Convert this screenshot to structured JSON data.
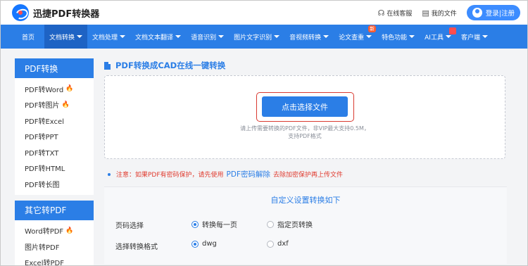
{
  "brand": {
    "name": "迅捷PDF转换器"
  },
  "top_links": [
    {
      "label": "在线客服",
      "icon": "headset-icon"
    },
    {
      "label": "我的文件",
      "icon": "file-icon"
    }
  ],
  "login": {
    "label": "登录|注册"
  },
  "nav": {
    "items": [
      {
        "label": "首页"
      },
      {
        "label": "文档转换"
      },
      {
        "label": "文档处理"
      },
      {
        "label": "文档文本翻译"
      },
      {
        "label": "语音识别"
      },
      {
        "label": "图片文字识别"
      },
      {
        "label": "音视频转换"
      },
      {
        "label": "论文查重"
      },
      {
        "label": "特色功能"
      },
      {
        "label": "AI工具"
      },
      {
        "label": "客户端"
      }
    ],
    "new_badge": "新"
  },
  "sidebar": {
    "section1_title": "PDF转换",
    "section1_items": [
      "PDF转Word",
      "PDF转图片",
      "PDF转Excel",
      "PDF转PPT",
      "PDF转TXT",
      "PDF转HTML",
      "PDF转长图"
    ],
    "section2_title": "其它转PDF",
    "section2_items": [
      "Word转PDF",
      "图片转PDF",
      "Excel转PDF"
    ]
  },
  "main": {
    "title": "PDF转换成CAD在线一键转换",
    "select_button": "点击选择文件",
    "hint_line1": "请上传需要转换的PDF文件，非VIP最大支持0.5M，",
    "hint_line2": "支持PDF格式",
    "notice_prefix": "注意：如果PDF有密码保护，请先使用",
    "notice_link": "PDF密码解除",
    "notice_suffix": "去除加密保护再上传文件"
  },
  "settings": {
    "title": "自定义设置转换如下",
    "page_label": "页码选择",
    "page_opt1": "转换每一页",
    "page_opt2": "指定页转换",
    "page_selected": "转换每一页",
    "format_label": "选择转换格式",
    "format_opt1": "dwg",
    "format_opt2": "dxf",
    "format_selected": "dwg"
  },
  "colors": {
    "primary": "#2b7ee6",
    "nav_active": "#1e63c4",
    "warning": "#e03b2f",
    "hot": "#ff6a1a"
  }
}
